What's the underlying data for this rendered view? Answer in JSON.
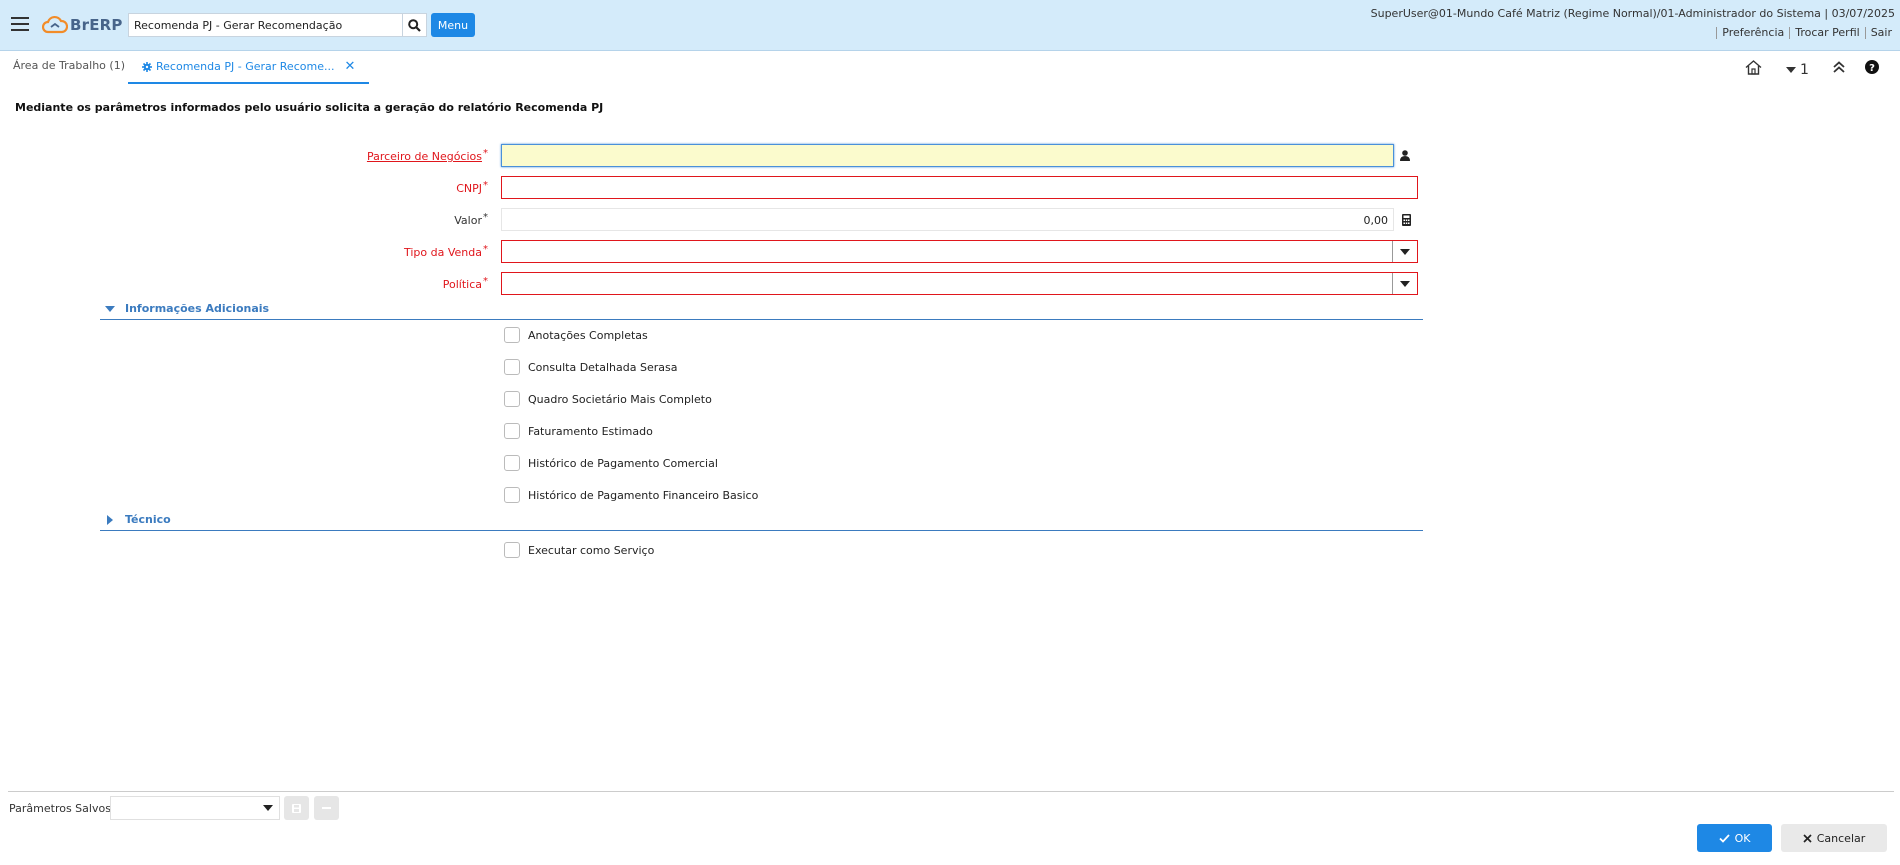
{
  "header": {
    "logo_text": "BrERP",
    "search_value": "Recomenda PJ - Gerar Recomendação",
    "menu_label": "Menu",
    "user_info": "SuperUser@01-Mundo Café Matriz (Regime Normal)/01-Administrador do Sistema | 03/07/2025",
    "links": {
      "preference": "Preferência",
      "change_role": "Trocar Perfil",
      "logout": "Sair"
    }
  },
  "tabs": {
    "workspace": "Área de Trabalho (1)",
    "active": "Recomenda PJ - Gerar Recome...",
    "window_count": "1"
  },
  "main": {
    "description": "Mediante os parâmetros informados pelo usuário solicita a geração do relatório Recomenda PJ",
    "fields": {
      "business_partner": {
        "label": "Parceiro de Negócios",
        "value": ""
      },
      "cnpj": {
        "label": "CNPJ",
        "value": ""
      },
      "valor": {
        "label": "Valor",
        "value": "0,00"
      },
      "sale_type": {
        "label": "Tipo da Venda",
        "value": ""
      },
      "policy": {
        "label": "Política",
        "value": ""
      }
    },
    "required_marker": "*",
    "sections": {
      "additional": {
        "title": "Informações Adicionais",
        "checkboxes": [
          "Anotações Completas",
          "Consulta Detalhada Serasa",
          "Quadro Societário Mais Completo",
          "Faturamento Estimado",
          "Histórico de Pagamento Comercial",
          "Histórico de Pagamento Financeiro Basico"
        ]
      },
      "technical": {
        "title": "Técnico",
        "checkboxes": [
          "Executar como Serviço"
        ]
      }
    }
  },
  "footer": {
    "saved_params_label": "Parâmetros Salvos",
    "saved_params_value": "",
    "ok_label": "OK",
    "cancel_label": "Cancelar"
  },
  "colors": {
    "header_bg": "#d4ebfa",
    "accent": "#1e88e5",
    "required_red": "#e0161c",
    "section_blue": "#3b7bbf",
    "focus_yellow": "#fbfbcd"
  },
  "icons": {
    "hamburger": "hamburger-icon",
    "search": "search-icon",
    "settings": "gear-icon",
    "close": "close-icon",
    "home": "home-icon",
    "dropdown": "caret-down-icon",
    "collapse": "double-chevron-up-icon",
    "help": "help-icon",
    "partner": "person-icon",
    "calculator": "calculator-icon",
    "ok": "check-icon",
    "cancel": "x-icon"
  }
}
